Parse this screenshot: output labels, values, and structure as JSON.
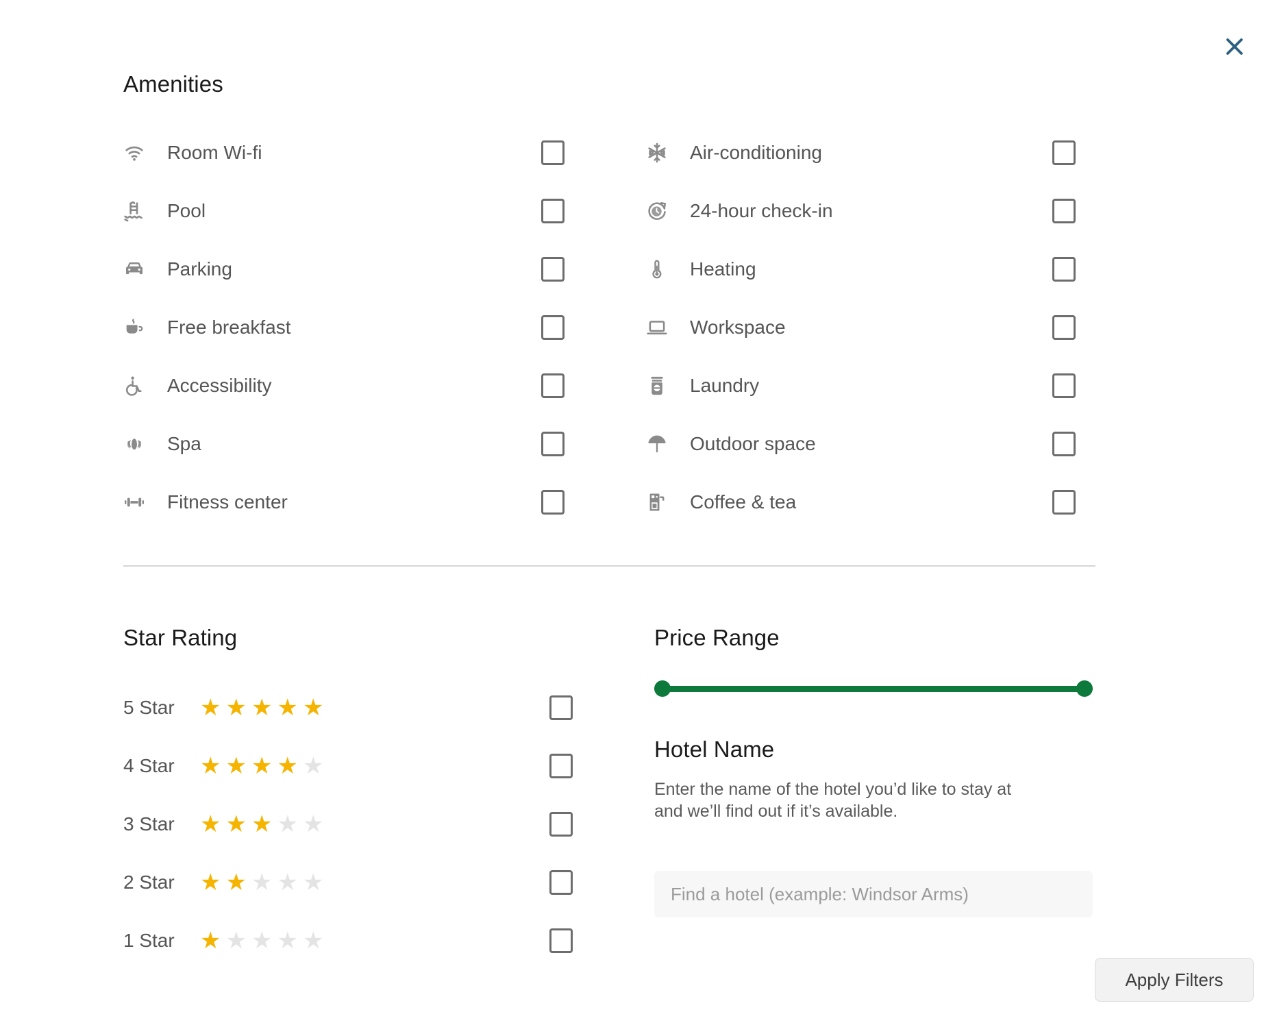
{
  "dialog": {
    "close_label": "×"
  },
  "amenities": {
    "title": "Amenities",
    "left": [
      {
        "label": "Room Wi-fi",
        "icon": "wifi-icon"
      },
      {
        "label": "Pool",
        "icon": "pool-icon"
      },
      {
        "label": "Parking",
        "icon": "car-icon"
      },
      {
        "label": "Free breakfast",
        "icon": "coffee-mug-icon"
      },
      {
        "label": "Accessibility",
        "icon": "wheelchair-icon"
      },
      {
        "label": "Spa",
        "icon": "lotus-icon"
      },
      {
        "label": "Fitness center",
        "icon": "dumbbell-icon"
      }
    ],
    "right": [
      {
        "label": "Air-conditioning",
        "icon": "snowflake-icon"
      },
      {
        "label": "24-hour check-in",
        "icon": "clock-icon"
      },
      {
        "label": "Heating",
        "icon": "thermometer-icon"
      },
      {
        "label": "Workspace",
        "icon": "laptop-icon"
      },
      {
        "label": "Laundry",
        "icon": "washer-icon"
      },
      {
        "label": "Outdoor space",
        "icon": "parasol-icon"
      },
      {
        "label": "Coffee & tea",
        "icon": "coffee-machine-icon"
      }
    ]
  },
  "star_rating": {
    "title": "Star Rating",
    "max_stars": 5,
    "rows": [
      {
        "label": "5 Star",
        "filled": 5
      },
      {
        "label": "4 Star",
        "filled": 4
      },
      {
        "label": "3 Star",
        "filled": 3
      },
      {
        "label": "2 Star",
        "filled": 2
      },
      {
        "label": "1 Star",
        "filled": 1
      }
    ]
  },
  "price_range": {
    "title": "Price Range",
    "low_percent": 0,
    "high_percent": 100
  },
  "hotel_name": {
    "title": "Hotel Name",
    "description": "Enter the name of the hotel you’d like to stay at and we’ll find out if it’s available.",
    "placeholder": "Find a hotel (example: Windsor Arms)",
    "value": ""
  },
  "footer": {
    "apply_label": "Apply Filters"
  },
  "colors": {
    "star_on": "#f5b400",
    "star_off": "#e4e4e4",
    "slider": "#0d7a3c",
    "close_icon": "#2d6080",
    "icon_grey": "#8a8a8a",
    "text_grey": "#555555"
  }
}
